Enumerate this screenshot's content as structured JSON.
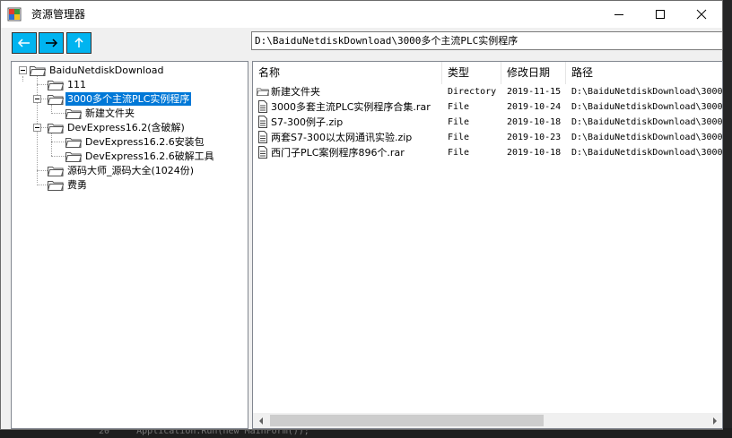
{
  "window": {
    "title": "资源管理器"
  },
  "toolbar": {
    "back_icon": "arrow-left-icon",
    "forward_icon": "arrow-right-icon",
    "up_icon": "arrow-up-icon",
    "path": "D:\\BaiduNetdiskDownload\\3000多个主流PLC实例程序"
  },
  "tree": {
    "root": "BaiduNetdiskDownload",
    "n111": "111",
    "plc": "3000多个主流PLC实例程序",
    "plc_child": "新建文件夹",
    "devexpress": "DevExpress16.2(含破解)",
    "dev_install": "DevExpress16.2.6安装包",
    "dev_crack": "DevExpress16.2.6破解工具",
    "source": "源码大师_源码大全(1024份)",
    "guiyong": "费勇"
  },
  "list": {
    "headers": [
      "名称",
      "类型",
      "修改日期",
      "路径"
    ],
    "rows": [
      {
        "name": "新建文件夹",
        "type": "Directory",
        "date": "2019-11-15",
        "path": "D:\\BaiduNetdiskDownload\\3000"
      },
      {
        "name": "3000多套主流PLC实例程序合集.rar",
        "type": "File",
        "date": "2019-10-24",
        "path": "D:\\BaiduNetdiskDownload\\3000"
      },
      {
        "name": "S7-300例子.zip",
        "type": "File",
        "date": "2019-10-18",
        "path": "D:\\BaiduNetdiskDownload\\3000"
      },
      {
        "name": "两套S7-300以太网通讯实验.zip",
        "type": "File",
        "date": "2019-10-23",
        "path": "D:\\BaiduNetdiskDownload\\3000"
      },
      {
        "name": "西门子PLC案例程序896个.rar",
        "type": "File",
        "date": "2019-10-18",
        "path": "D:\\BaiduNetdiskDownload\\3000"
      }
    ]
  },
  "background": {
    "code_snippet": "20     Application.Run(new MainForm());"
  },
  "colors": {
    "nav_button": "#00b4f0",
    "selection": "#0078d7"
  }
}
